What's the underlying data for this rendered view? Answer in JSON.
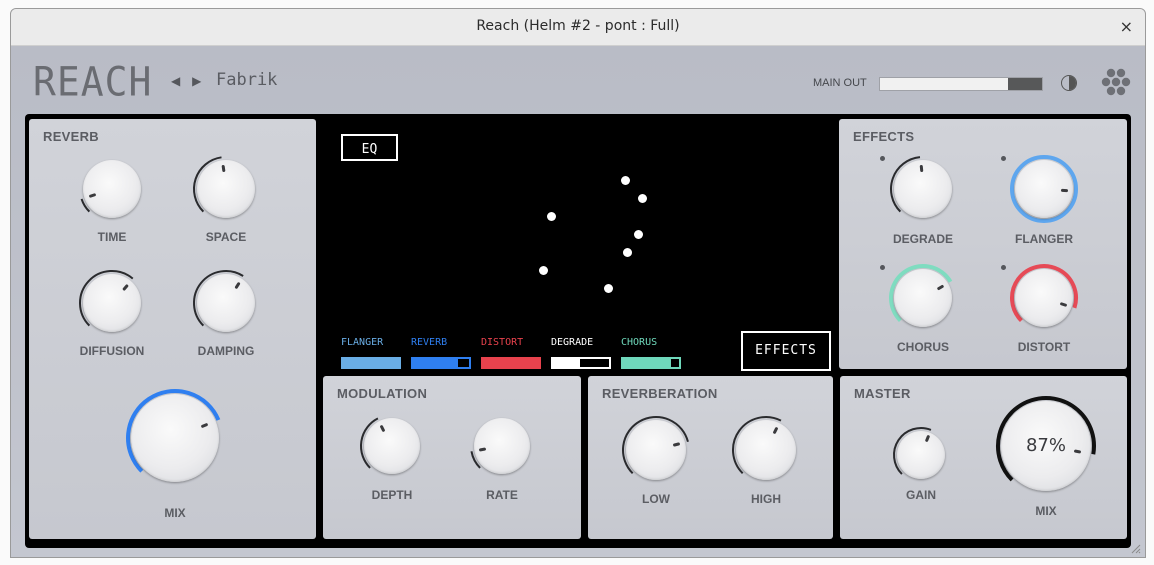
{
  "window": {
    "title": "Reach (Helm #2 - pont : Full)",
    "close_glyph": "×"
  },
  "header": {
    "logo": "REACH",
    "prev": "◀",
    "next": "▶",
    "preset": "Fabrik",
    "main_out_label": "MAIN OUT",
    "main_out_level": 0.79
  },
  "reverb": {
    "title": "REVERB",
    "knobs": [
      {
        "label": "TIME",
        "value": 0.1
      },
      {
        "label": "SPACE",
        "value": 0.47
      },
      {
        "label": "DIFFUSION",
        "value": 0.65
      },
      {
        "label": "DAMPING",
        "value": 0.62
      }
    ],
    "mix": {
      "label": "MIX",
      "value": 0.75
    }
  },
  "viz": {
    "eq_label": "EQ",
    "effects_label": "EFFECTS",
    "legend": [
      {
        "name": "FLANGER",
        "color": "#6aaee6",
        "fill": 1.0,
        "border": "#6aaee6"
      },
      {
        "name": "REVERB",
        "color": "#2f7ff0",
        "fill": 0.8,
        "border": "#2f7ff0"
      },
      {
        "name": "DISTORT",
        "color": "#e8424d",
        "fill": 1.0,
        "border": "#e8424d"
      },
      {
        "name": "DEGRADE",
        "color": "#ffffff",
        "fill": 0.48,
        "border": "#ffffff"
      },
      {
        "name": "CHORUS",
        "color": "#6fd8bb",
        "fill": 0.85,
        "border": "#6fd8bb"
      }
    ]
  },
  "effects": {
    "title": "EFFECTS",
    "knobs": [
      {
        "label": "DEGRADE",
        "value": 0.48,
        "accent": "#8a8c92"
      },
      {
        "label": "FLANGER",
        "value": 0.85,
        "accent": "#5ea6ee"
      },
      {
        "label": "CHORUS",
        "value": 0.72,
        "accent": "#7fdcc0"
      },
      {
        "label": "DISTORT",
        "value": 0.9,
        "accent": "#e64a56"
      }
    ]
  },
  "modulation": {
    "title": "MODULATION",
    "knobs": [
      {
        "label": "DEPTH",
        "value": 0.4
      },
      {
        "label": "RATE",
        "value": 0.13
      }
    ]
  },
  "reverberation": {
    "title": "REVERBERATION",
    "knobs": [
      {
        "label": "LOW",
        "value": 0.78
      },
      {
        "label": "HIGH",
        "value": 0.6
      }
    ]
  },
  "master": {
    "title": "MASTER",
    "gain": {
      "label": "GAIN",
      "value": 0.58
    },
    "mix": {
      "label": "MIX",
      "value": 0.87,
      "display": "87%"
    }
  }
}
